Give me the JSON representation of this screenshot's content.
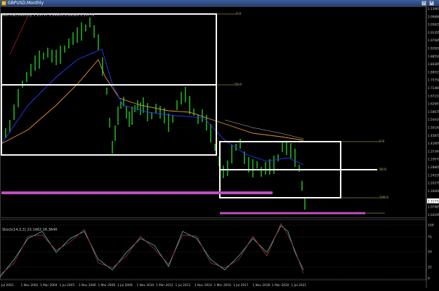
{
  "window": {
    "title": "GBPUSD,Monthly",
    "restore_label": "▫",
    "close_label": "×"
  },
  "main_chart": {
    "symbol_line": "GBPUSD,Monthly  1.15757 1.14953 1.09320 1.11772",
    "price_ticks": [
      "2.13961",
      "2.09890",
      "2.05625",
      "2.01355",
      "1.97085",
      "1.92820",
      "1.88550",
      "1.84285",
      "1.80015",
      "1.75750",
      "1.71480",
      "1.67210",
      "1.62945",
      "1.58675",
      "1.54410",
      "1.50140",
      "1.45875",
      "1.41605",
      "1.37340",
      "1.33070",
      "1.28805",
      "1.24535",
      "1.20270",
      "1.16000",
      "1.11772",
      "1.07465",
      "1.03195"
    ],
    "current_price": "1.11772",
    "fib_levels": [
      "0.0",
      "50.0",
      "100.0"
    ]
  },
  "oscillator": {
    "label": "Stoch(14,3,3) 23.1462 26.3640",
    "levels": [
      "100",
      "75",
      "50",
      "25",
      "0"
    ]
  },
  "time_axis": [
    "Jul 2001",
    "1 Nov 2002",
    "1 Mar 2004",
    "1 Jul 2005",
    "1 Nov 2006",
    "1 Mar 2008",
    "1 Jul 2009",
    "1 Nov 2010",
    "1 Mar 2012",
    "1 Jul 2013",
    "1 Nov 2014",
    "1 Mar 2016",
    "1 Jul 2017",
    "1 Nov 2018",
    "1 Mar 2020",
    "1 Jul 2021"
  ],
  "colors": {
    "background": "#000000",
    "candles": "#22cc22",
    "ma_orange": "#e8962a",
    "ma_blue": "#2a3aff",
    "boxes": "#ffffff",
    "magenta_lines": "#c050c0",
    "stoch_main": "#3fbfbf",
    "stoch_signal": "#d03030",
    "current_price_bg": "#ffffff"
  }
}
